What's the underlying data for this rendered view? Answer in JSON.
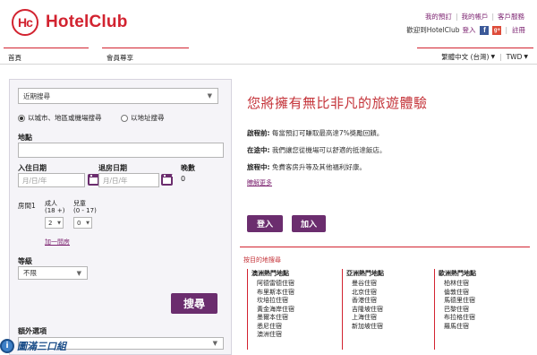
{
  "brand": {
    "logo_mark": "Hc",
    "name": "HotelClub"
  },
  "top_links": [
    "我的預訂",
    "我的帳戶",
    "客戶服務"
  ],
  "welcome": {
    "text": "歡迎到HotelClub",
    "login": "登入",
    "register": "註冊"
  },
  "nav": {
    "home": "首頁",
    "member": "會員尊享",
    "language": "繁體中文 (台灣)",
    "currency": "TWD"
  },
  "search": {
    "recent_select": "近期搜尋",
    "radio_city": "以城市、地區或機場搜尋",
    "radio_address": "以地址搜尋",
    "location_label": "地點",
    "checkin_label": "入住日期",
    "checkin_placeholder": "月/日/年",
    "checkout_label": "退房日期",
    "checkout_placeholder": "月/日/年",
    "nights_label": "晚數",
    "nights_value": "0",
    "room_label": "房間1",
    "adults_label": "成人",
    "adults_range": "(18 +)",
    "adults_value": "2",
    "children_label": "兒童",
    "children_range": "(0 - 17)",
    "children_value": "0",
    "add_room": "加一間房",
    "grade_label": "等級",
    "grade_value": "不限",
    "search_button": "搜尋",
    "extra_label": "額外選項"
  },
  "watermark": {
    "icon": "i",
    "text": "圖滿三口組"
  },
  "promo": {
    "title": "您將擁有無比非凡的旅遊體驗",
    "rows": [
      {
        "head": "啟程前:",
        "text": "每當預訂可賺取最高達7%獎勵回饋。"
      },
      {
        "head": "在途中:",
        "text": "我們讓您從機場可以舒適的抵達飯店。"
      },
      {
        "head": "旅程中:",
        "text": "免費客房升等及其他福利好康。"
      }
    ],
    "more_link": "瞭解更多",
    "login_button": "登入",
    "join_button": "加入"
  },
  "destinations": {
    "title": "按目的地搜尋",
    "columns": [
      {
        "head": "澳洲熱門地點",
        "items": [
          "阿德雷德住宿",
          "布里斯本住宿",
          "坎培拉住宿",
          "黃金海岸住宿",
          "墨爾本住宿",
          "悉尼住宿",
          "澳洲住宿"
        ]
      },
      {
        "head": "亞洲熱門地點",
        "items": [
          "曼谷住宿",
          "北京住宿",
          "香港住宿",
          "吉隆坡住宿",
          "上海住宿",
          "新加坡住宿"
        ]
      },
      {
        "head": "歐洲熱門地點",
        "items": [
          "柏林住宿",
          "倫敦住宿",
          "馬德里住宿",
          "巴黎住宿",
          "布拉格住宿",
          "羅馬住宿"
        ]
      }
    ]
  },
  "colors": {
    "brand_red": "#d22330",
    "purple": "#6b2d6e"
  }
}
